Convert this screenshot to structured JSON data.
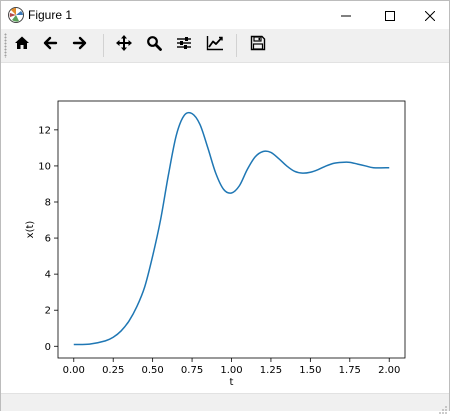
{
  "window": {
    "title": "Figure 1",
    "app_icon": "matplotlib-icon",
    "controls": [
      "minimize-icon",
      "maximize-icon",
      "close-icon"
    ]
  },
  "toolbar": {
    "buttons": [
      {
        "name": "home",
        "icon": "home-icon"
      },
      {
        "name": "back",
        "icon": "arrow-left-icon"
      },
      {
        "name": "forward",
        "icon": "arrow-right-icon"
      },
      {
        "name": "pan",
        "icon": "move-icon"
      },
      {
        "name": "zoom",
        "icon": "magnifier-icon"
      },
      {
        "name": "subplots",
        "icon": "sliders-icon"
      },
      {
        "name": "customize",
        "icon": "line-chart-icon"
      },
      {
        "name": "save",
        "icon": "floppy-disk-icon"
      }
    ]
  },
  "chart_data": {
    "type": "line",
    "title": "",
    "xlabel": "t",
    "ylabel": "x(t)",
    "xlim": [
      -0.1,
      2.1
    ],
    "ylim": [
      -0.65,
      13.6
    ],
    "xticks": [
      "0.00",
      "0.25",
      "0.50",
      "0.75",
      "1.00",
      "1.25",
      "1.50",
      "1.75",
      "2.00"
    ],
    "xtick_values": [
      0,
      0.25,
      0.5,
      0.75,
      1.0,
      1.25,
      1.5,
      1.75,
      2.0
    ],
    "yticks": [
      "0",
      "2",
      "4",
      "6",
      "8",
      "10",
      "12"
    ],
    "ytick_values": [
      0,
      2,
      4,
      6,
      8,
      10,
      12
    ],
    "grid": false,
    "line_color": "#1f77b4",
    "series": [
      {
        "x": [
          0.0,
          0.1,
          0.2,
          0.25,
          0.3,
          0.35,
          0.4,
          0.45,
          0.5,
          0.55,
          0.6,
          0.65,
          0.7,
          0.75,
          0.8,
          0.85,
          0.9,
          0.95,
          1.0,
          1.05,
          1.1,
          1.15,
          1.2,
          1.25,
          1.3,
          1.35,
          1.4,
          1.45,
          1.5,
          1.55,
          1.6,
          1.65,
          1.7,
          1.75,
          1.8,
          1.85,
          1.9,
          2.0
        ],
        "y": [
          0.1,
          0.12,
          0.3,
          0.5,
          0.85,
          1.4,
          2.2,
          3.3,
          5.0,
          7.0,
          9.5,
          11.7,
          12.8,
          12.9,
          12.3,
          11.0,
          9.6,
          8.7,
          8.5,
          8.9,
          9.8,
          10.5,
          10.8,
          10.75,
          10.4,
          10.0,
          9.7,
          9.6,
          9.65,
          9.8,
          10.0,
          10.15,
          10.2,
          10.2,
          10.1,
          10.0,
          9.9,
          9.9
        ]
      }
    ]
  }
}
